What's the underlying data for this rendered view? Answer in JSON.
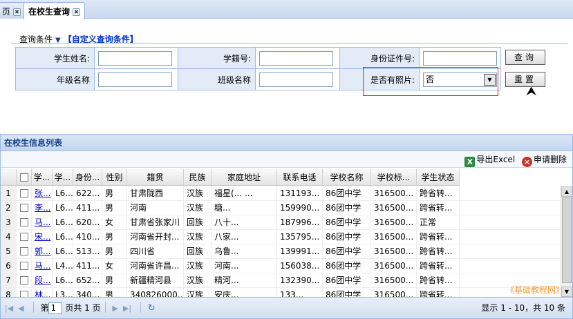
{
  "tabs": [
    {
      "label": "页"
    },
    {
      "label": "在校生查询"
    }
  ],
  "query": {
    "title": "查询条件",
    "custom_link": "【自定义查询条件】",
    "labels": {
      "name": "学生姓名:",
      "sno": "学籍号:",
      "idcard": "身份证件号:",
      "grade": "年级名称",
      "class": "班级名称",
      "photo": "是否有照片:"
    },
    "photo_value": "否",
    "search_btn": "查询",
    "reset_btn": "重置"
  },
  "grid": {
    "title": "在校生信息列表",
    "export_label": "导出Excel",
    "delete_label": "申请删除",
    "columns": [
      "学...",
      "学...",
      "身份...",
      "性别",
      "籍贯",
      "民族",
      "家庭地址",
      "联系电话",
      "学校名称",
      "学校标...",
      "学生状态"
    ],
    "rows": [
      {
        "n": "1",
        "name": "张...",
        "sno": "L6...",
        "id": "622...",
        "sex": "男",
        "origin": "甘肃陇西",
        "nation": "汉族",
        "addr": "福星(...  ...",
        "phone": "131193...",
        "school": "86团中学",
        "code": "316500...",
        "status": "跨省转..."
      },
      {
        "n": "2",
        "name": "李...",
        "sno": "L6...",
        "id": "411...",
        "sex": "男",
        "origin": "河南",
        "nation": "汉族",
        "addr": "糖...",
        "phone": "159990...",
        "school": "86团中学",
        "code": "316500...",
        "status": "跨省转..."
      },
      {
        "n": "3",
        "name": "马...",
        "sno": "L6...",
        "id": "620...",
        "sex": "女",
        "origin": "甘肃省张家川",
        "nation": "回族",
        "addr": "八十...",
        "phone": "187996...",
        "school": "86团中学",
        "code": "316500...",
        "status": "正常"
      },
      {
        "n": "4",
        "name": "宋...",
        "sno": "L6...",
        "id": "410...",
        "sex": "男",
        "origin": "河南省开封...",
        "nation": "汉族",
        "addr": "八家...",
        "phone": "135795...",
        "school": "86团中学",
        "code": "316500...",
        "status": "跨省转..."
      },
      {
        "n": "5",
        "name": "郭...",
        "sno": "L6...",
        "id": "513...",
        "sex": "男",
        "origin": "四川省",
        "nation": "回族",
        "addr": "乌鲁...",
        "phone": "139991...",
        "school": "86团中学",
        "code": "316500...",
        "status": "跨省转..."
      },
      {
        "n": "6",
        "name": "马...",
        "sno": "L4...",
        "id": "411...",
        "sex": "女",
        "origin": "河南省许昌...",
        "nation": "汉族",
        "addr": "河南...",
        "phone": "156038...",
        "school": "86团中学",
        "code": "316500...",
        "status": "跨省转..."
      },
      {
        "n": "7",
        "name": "段...",
        "sno": "L6...",
        "id": "652...",
        "sex": "男",
        "origin": "新疆精河县",
        "nation": "汉族",
        "addr": "精河...",
        "phone": "132390...",
        "school": "86团中学",
        "code": "316500...",
        "status": "跨省转..."
      },
      {
        "n": "8",
        "name": "林...",
        "sno": "L3...",
        "id": "340...",
        "sex": "男",
        "origin": "340826000...",
        "nation": "汉族",
        "addr": "安庆...",
        "phone": "133...",
        "school": "86团中学",
        "code": "316500...",
        "status": "跨省转..."
      }
    ]
  },
  "pager": {
    "page_label": "第",
    "page_value": "1",
    "of_label": "页共 1 页",
    "display": "显示 1 - 10，共 10 条"
  },
  "watermark": "《基础教程网》"
}
